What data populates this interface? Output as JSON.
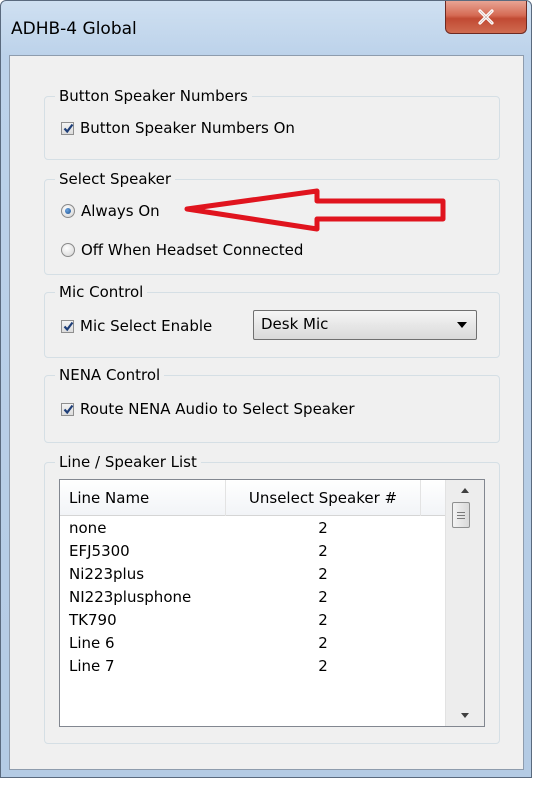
{
  "window": {
    "title": "ADHB-4 Global"
  },
  "button_speaker_numbers": {
    "legend": "Button Speaker Numbers",
    "checkbox_label": "Button Speaker Numbers On",
    "checked": true
  },
  "select_speaker": {
    "legend": "Select Speaker",
    "options": [
      {
        "label": "Always On",
        "selected": true
      },
      {
        "label": "Off When Headset Connected",
        "selected": false
      }
    ]
  },
  "mic_control": {
    "legend": "Mic Control",
    "checkbox_label": "Mic Select Enable",
    "checked": true,
    "dropdown_value": "Desk Mic"
  },
  "nena_control": {
    "legend": "NENA Control",
    "checkbox_label": "Route NENA Audio to Select Speaker",
    "checked": true
  },
  "line_speaker_list": {
    "legend": "Line / Speaker List",
    "columns": [
      "Line Name",
      "Unselect Speaker #"
    ],
    "rows": [
      [
        "none",
        "2"
      ],
      [
        "EFJ5300",
        "2"
      ],
      [
        "Ni223plus",
        "2"
      ],
      [
        "NI223plusphone",
        "2"
      ],
      [
        "TK790",
        "2"
      ],
      [
        "Line 6",
        "2"
      ],
      [
        "Line 7",
        "2"
      ]
    ]
  },
  "annotation": {
    "type": "red-arrow-pointing-left",
    "color": "#e0141e"
  },
  "colors": {
    "accent": "#1d4f8f",
    "close_button": "#c14a33",
    "annotation": "#e0141e"
  }
}
